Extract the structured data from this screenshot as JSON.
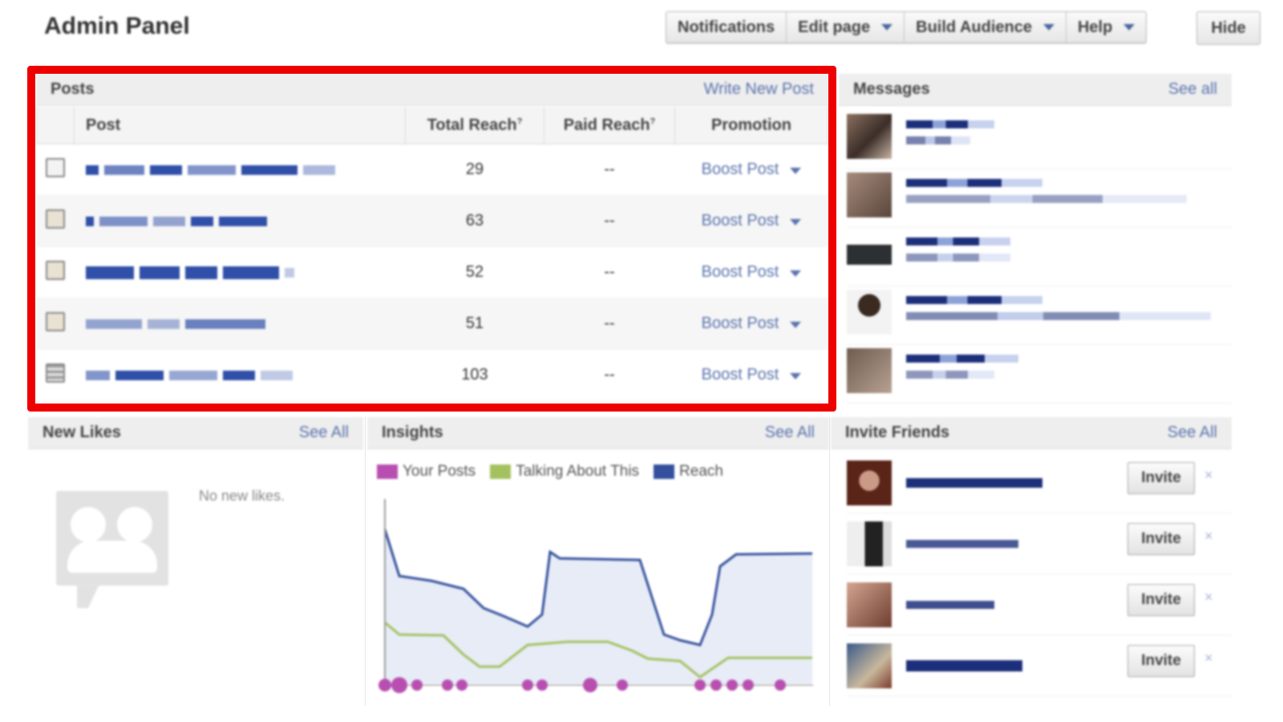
{
  "header": {
    "title": "Admin Panel",
    "buttons": {
      "notifications": "Notifications",
      "edit_page": "Edit page",
      "build_audience": "Build Audience",
      "help": "Help",
      "hide": "Hide"
    }
  },
  "posts": {
    "title": "Posts",
    "write_link": "Write New Post",
    "columns": {
      "post": "Post",
      "total_reach": "Total Reach",
      "paid_reach": "Paid Reach",
      "promotion": "Promotion",
      "info_mark": "?"
    },
    "rows": [
      {
        "total_reach": "29",
        "paid_reach": "--",
        "promotion": "Boost Post",
        "icon": "link-post-icon"
      },
      {
        "total_reach": "63",
        "paid_reach": "--",
        "promotion": "Boost Post",
        "icon": "photo-post-icon"
      },
      {
        "total_reach": "52",
        "paid_reach": "--",
        "promotion": "Boost Post",
        "icon": "photo-post-icon"
      },
      {
        "total_reach": "51",
        "paid_reach": "--",
        "promotion": "Boost Post",
        "icon": "photo-post-icon"
      },
      {
        "total_reach": "103",
        "paid_reach": "--",
        "promotion": "Boost Post",
        "icon": "video-post-icon"
      }
    ]
  },
  "messages": {
    "title": "Messages",
    "see_all": "See all"
  },
  "new_likes": {
    "title": "New Likes",
    "see_all": "See All",
    "empty": "No new likes."
  },
  "insights": {
    "title": "Insights",
    "see_all": "See All",
    "legend": [
      {
        "name": "Your Posts",
        "color": "#b84fb0"
      },
      {
        "name": "Talking About This",
        "color": "#a4c160"
      },
      {
        "name": "Reach",
        "color": "#34509c"
      }
    ]
  },
  "invite_friends": {
    "title": "Invite Friends",
    "see_all": "See All",
    "invite_label": "Invite",
    "dismiss": "×"
  },
  "colors": {
    "link": "#5a73ad",
    "highlight_border": "#ee0000"
  }
}
